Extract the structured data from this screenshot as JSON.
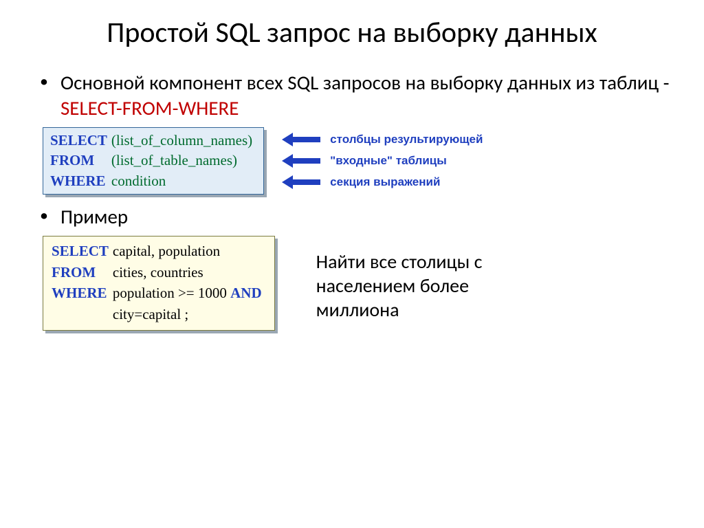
{
  "title": "Простой SQL запрос на выборку данных",
  "bullet_main": {
    "prefix": "Основной компонент всех SQL запросов на выборку данных из таблиц - ",
    "highlight": "SELECT-FROM-WHERE"
  },
  "code_template": {
    "select_kw": "SELECT",
    "select_arg": "(list_of_column_names)",
    "from_kw": "FROM",
    "from_arg": "(list_of_table_names)",
    "where_kw": "WHERE",
    "where_arg": "condition"
  },
  "arrow_labels": {
    "a": "столбцы результирующей",
    "b": "\"входные\" таблицы",
    "c": "секция выражений"
  },
  "example_label": "Пример",
  "code_example": {
    "select_kw": "SELECT",
    "select_arg": "capital, population",
    "from_kw": "FROM",
    "from_arg": "cities, countries",
    "where_kw": "WHERE",
    "where_line1a": "population  >= 1000 ",
    "where_and": "AND",
    "where_line2": "city=capital ;"
  },
  "example_desc": "Найти все столицы с населением более миллиона"
}
